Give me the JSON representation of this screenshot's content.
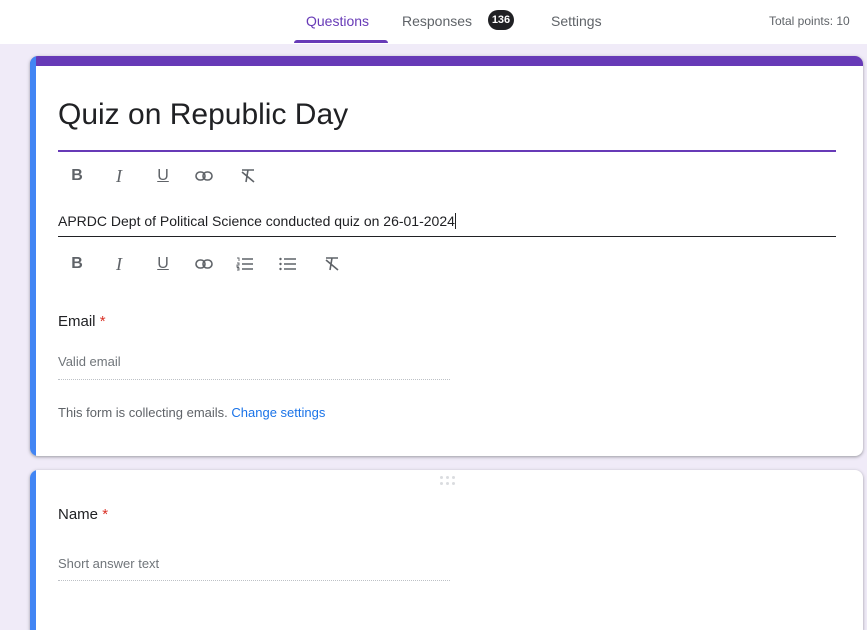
{
  "header": {
    "tabs": [
      {
        "label": "Questions",
        "active": true
      },
      {
        "label": "Responses",
        "badge": "136"
      },
      {
        "label": "Settings"
      }
    ],
    "total_points": "Total points: 10"
  },
  "form": {
    "title": "Quiz on Republic Day",
    "description": "APRDC Dept of Political Science conducted quiz on 26-01-2024",
    "title_toolbar": [
      "bold-icon",
      "italic-icon",
      "underline-icon",
      "link-icon",
      "clear-format-icon"
    ],
    "desc_toolbar": [
      "bold-icon",
      "italic-icon",
      "underline-icon",
      "link-icon",
      "numbered-list-icon",
      "bulleted-list-icon",
      "clear-format-icon"
    ]
  },
  "email_question": {
    "label": "Email",
    "required_mark": "*",
    "placeholder": "Valid email",
    "note": "This form is collecting emails.",
    "note_link": "Change settings"
  },
  "name_question": {
    "label": "Name",
    "required_mark": "*",
    "placeholder": "Short answer text"
  },
  "colors": {
    "accent": "#673ab7",
    "focus": "#4285f4",
    "link": "#1a73e8",
    "required": "#d93025"
  }
}
